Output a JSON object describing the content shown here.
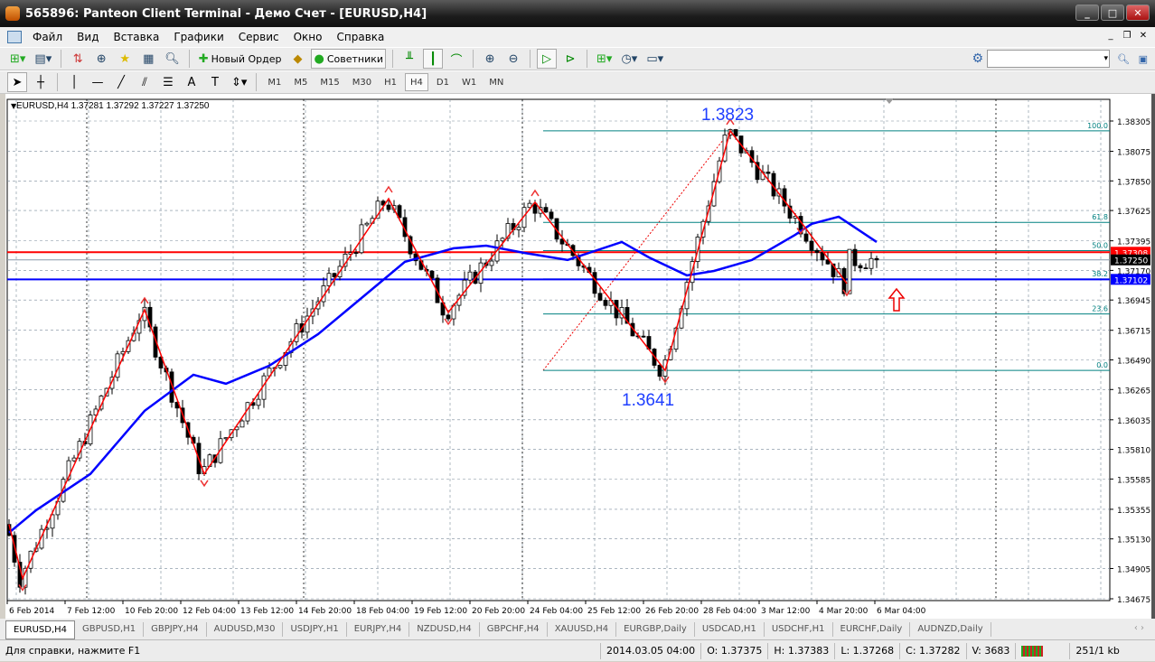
{
  "window": {
    "title": "565896: Panteon Client Terminal - Демо Счет - [EURUSD,H4]",
    "min": "_",
    "max": "□",
    "close": "✕"
  },
  "menu": [
    "Файл",
    "Вид",
    "Вставка",
    "Графики",
    "Сервис",
    "Окно",
    "Справка"
  ],
  "toolbar1": {
    "new_order": "Новый Ордер",
    "experts": "Советники"
  },
  "toolbar2": {
    "timeframes": [
      "M1",
      "M5",
      "M15",
      "M30",
      "H1",
      "H4",
      "D1",
      "W1",
      "MN"
    ],
    "active": "H4"
  },
  "chart": {
    "header": "EURUSD,H4  1.37281 1.37292 1.37227 1.37250",
    "high_label": "1.3823",
    "low_label": "1.3641",
    "price_labels": {
      "red": "1.37308",
      "bid": "1.37250",
      "blue": "1.37102"
    },
    "colors": {
      "zigzag": "#ff0000",
      "ma": "#0000ff",
      "fib": "#008080",
      "up": "#ffffff",
      "down": "#000000"
    }
  },
  "chart_data": {
    "type": "candlestick",
    "symbol": "EURUSD",
    "timeframe": "H4",
    "ylim": [
      1.3455,
      1.3855
    ],
    "yticks": [
      "1.38305",
      "1.38075",
      "1.37850",
      "1.37625",
      "1.37395",
      "1.37170",
      "1.36945",
      "1.36715",
      "1.36490",
      "1.36265",
      "1.36035",
      "1.35810",
      "1.35585",
      "1.35355",
      "1.35130",
      "1.34905",
      "1.34675"
    ],
    "xticks": [
      "6 Feb 2014",
      "7 Feb 12:00",
      "10 Feb 20:00",
      "12 Feb 04:00",
      "13 Feb 12:00",
      "14 Feb 20:00",
      "18 Feb 04:00",
      "19 Feb 12:00",
      "20 Feb 20:00",
      "24 Feb 04:00",
      "25 Feb 12:00",
      "26 Feb 20:00",
      "28 Feb 04:00",
      "3 Mar 12:00",
      "4 Mar 20:00",
      "6 Mar 04:00"
    ],
    "candle_count": 161,
    "zigzag": [
      [
        0,
        1.3524
      ],
      [
        2.5,
        1.3483
      ],
      [
        25,
        1.36871
      ],
      [
        36,
        1.35623
      ],
      [
        70,
        1.37715
      ],
      [
        81,
        1.36851
      ],
      [
        97,
        1.37688
      ],
      [
        121,
        1.3641
      ],
      [
        133,
        1.3823
      ],
      [
        146,
        1.3754
      ],
      [
        154.5,
        1.3707
      ]
    ],
    "ma": [
      [
        0,
        1.35177
      ],
      [
        5,
        1.35348
      ],
      [
        15,
        1.35623
      ],
      [
        25,
        1.36103
      ],
      [
        34,
        1.36377
      ],
      [
        40,
        1.36309
      ],
      [
        48,
        1.36446
      ],
      [
        57,
        1.36686
      ],
      [
        65,
        1.3696
      ],
      [
        73,
        1.37235
      ],
      [
        82,
        1.37338
      ],
      [
        88,
        1.37358
      ],
      [
        95,
        1.37303
      ],
      [
        103,
        1.37249
      ],
      [
        113,
        1.37386
      ],
      [
        118,
        1.37269
      ],
      [
        125,
        1.37132
      ],
      [
        130,
        1.37166
      ],
      [
        137,
        1.37249
      ],
      [
        145,
        1.37441
      ],
      [
        148,
        1.37523
      ],
      [
        153,
        1.37578
      ],
      [
        160,
        1.37386
      ]
    ],
    "fibonacci": {
      "high": 1.3823,
      "low": 1.3641,
      "levels": [
        "100.0",
        "61.8",
        "50.0",
        "38.2",
        "23.6",
        "0.0"
      ]
    },
    "hlines": {
      "red": 1.37308,
      "blue": 1.37102,
      "bid": 1.3725
    },
    "last_close": 1.3725
  },
  "tabs": [
    "EURUSD,H4",
    "GBPUSD,H1",
    "GBPJPY,H4",
    "AUDUSD,M30",
    "USDJPY,H1",
    "EURJPY,H4",
    "NZDUSD,H4",
    "GBPCHF,H4",
    "XAUUSD,H4",
    "EURGBP,Daily",
    "USDCAD,H1",
    "USDCHF,H1",
    "EURCHF,Daily",
    "AUDNZD,Daily"
  ],
  "status": {
    "help": "Для справки, нажмите F1",
    "time": "2014.03.05 04:00",
    "open": "O: 1.37375",
    "high": "H: 1.37383",
    "low": "L: 1.37268",
    "close": "C: 1.37282",
    "volume": "V: 3683",
    "traffic": "251/1 kb"
  }
}
